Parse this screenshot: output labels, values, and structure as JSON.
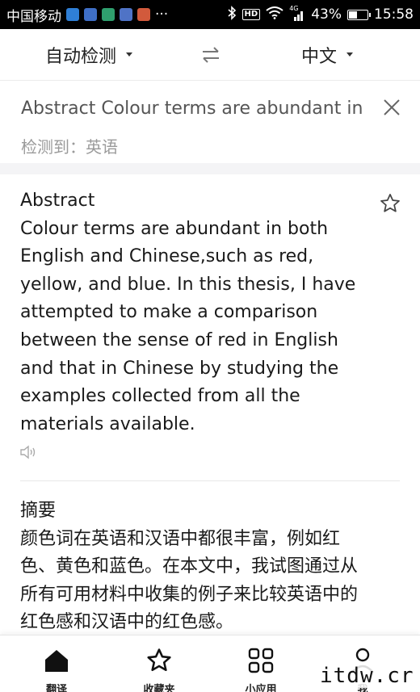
{
  "status_bar": {
    "carrier": "中国移动",
    "extra": "···",
    "signal_label": "4G",
    "hd": "HD",
    "battery_percent": "43%",
    "battery_level": 0.43,
    "time": "15:58",
    "app_icons": [
      "#2f7fd6",
      "#3f6fc6",
      "#2f9f6e",
      "#4f73c6",
      "#d25a3c"
    ]
  },
  "lang_bar": {
    "source": "自动检测",
    "target": "中文",
    "swap_icon": "swap-arrows-icon"
  },
  "input": {
    "text": "Abstract Colour terms are abundant in both English and Chinese,such as red, yellow, and blue.",
    "detected": "检测到：英语"
  },
  "result": {
    "source_text": "Abstract\nColour terms are abundant in both\nEnglish and Chinese,such as red,\nyellow, and blue. In this thesis, I have\nattempted to make a comparison\nbetween the sense of red in English\nand that in Chinese by studying the\nexamples collected from all the\nmaterials available.",
    "translation": "摘要\n颜色词在英语和汉语中都很丰富，例如红\n色、黄色和蓝色。在本文中，我试图通过从\n所有可用材料中收集的例子来比较英语中的\n红色感和汉语中的红色感。"
  },
  "bottom_nav": {
    "items": [
      {
        "label": "翻译",
        "icon": "home-icon"
      },
      {
        "label": "收藏夹",
        "icon": "star-icon"
      },
      {
        "label": "小应用",
        "icon": "grid-icon"
      },
      {
        "label": "我",
        "icon": "user-icon"
      }
    ]
  },
  "watermark": "itdw.cr"
}
